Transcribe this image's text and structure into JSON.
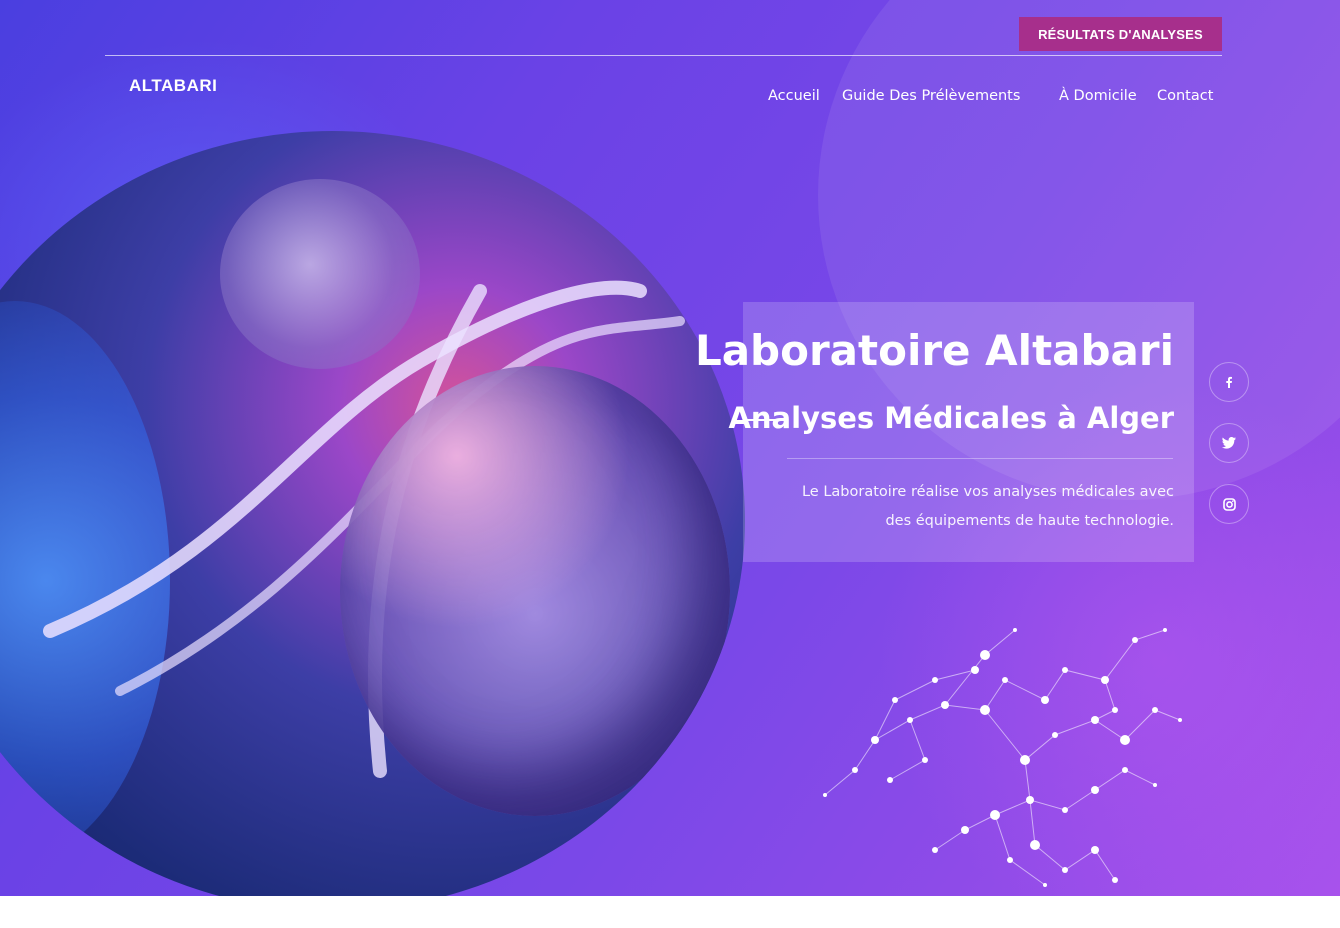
{
  "header": {
    "results_button": "RÉSULTATS D'ANALYSES",
    "logo": "ALTABARI",
    "nav": [
      "Accueil",
      "Guide Des Prélèvements",
      "À Domicile",
      "Contact"
    ]
  },
  "hero": {
    "title": "Laboratoire Altabari",
    "subtitle": "Analyses Médicales à Alger",
    "description": "Le Laboratoire réalise vos analyses médicales avec des équipements de haute technologie."
  },
  "social": {
    "icons": [
      "facebook-icon",
      "twitter-icon",
      "instagram-icon"
    ]
  },
  "colors": {
    "accent": "#a72f8c",
    "background_start": "#4a3fe0",
    "background_end": "#a852ec"
  }
}
